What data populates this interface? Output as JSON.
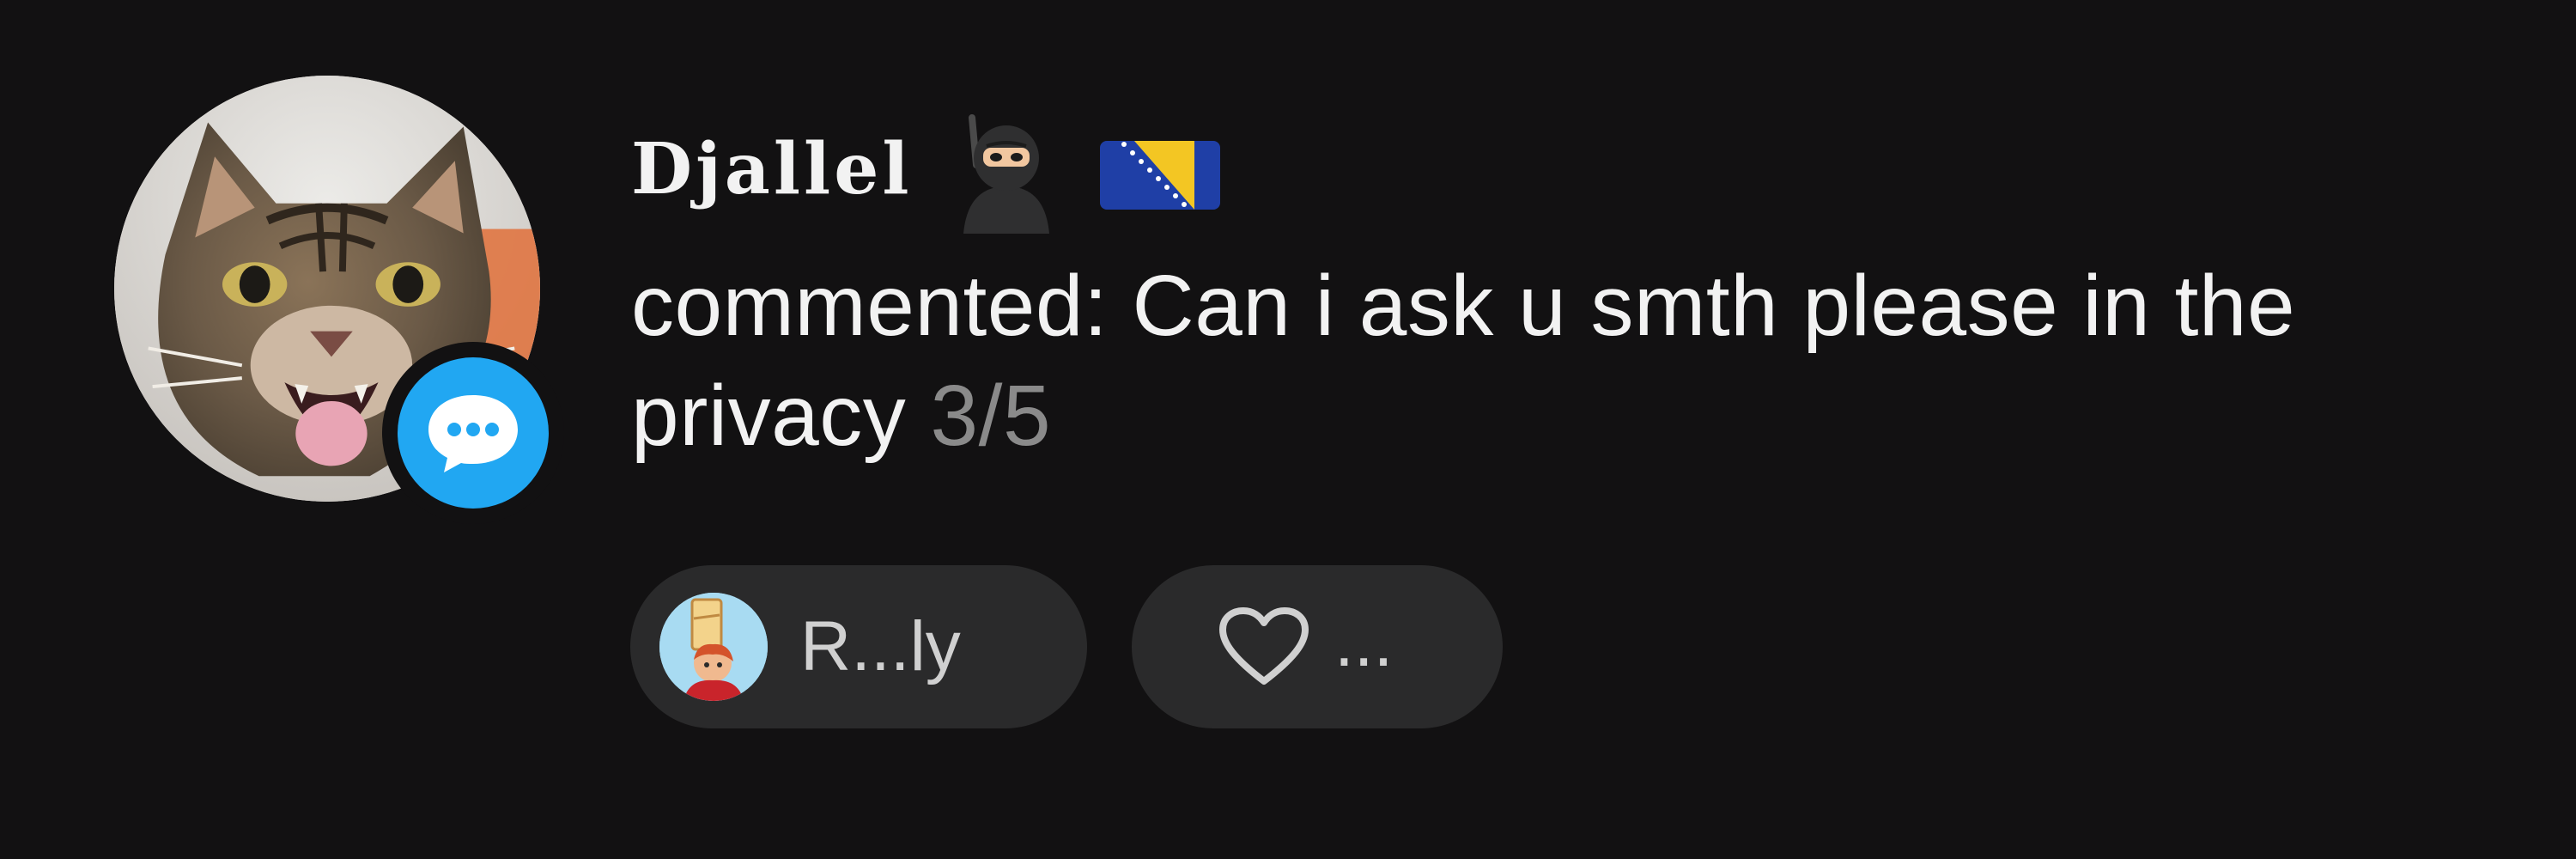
{
  "comment": {
    "username": "Djallel",
    "username_emojis": [
      "ninja-emoji-icon",
      "bosnia-flag-icon"
    ],
    "text": "commented: Can i ask u smth please in the privacy",
    "count": "3/5",
    "avatar": "cat-avatar",
    "badge_icon": "comment-bubble-icon"
  },
  "actions": {
    "reply_label": "R...ly",
    "reply_avatar": "cartoon-avatar",
    "like_label": "...",
    "like_icon": "heart-icon"
  },
  "colors": {
    "background": "#121112",
    "text_primary": "#f2f2f2",
    "text_muted": "#8a8a8a",
    "pill_background": "#2a2a2b",
    "badge_blue": "#21a7f2"
  }
}
